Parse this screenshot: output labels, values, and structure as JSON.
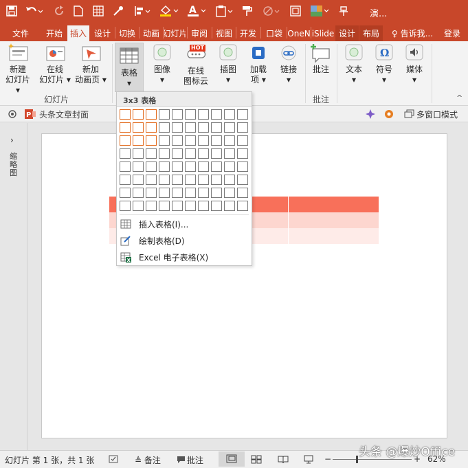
{
  "title_bar": {
    "doc_title": "演...",
    "quick_access": [
      "save-icon",
      "undo-icon",
      "redo-icon",
      "new-file-icon",
      "grid-icon",
      "eyedropper-icon",
      "align-icon",
      "fill-color-icon",
      "font-color-icon",
      "paste-icon",
      "format-painter-icon",
      "shape-icon",
      "frame-icon",
      "color-icon",
      "more-icon"
    ]
  },
  "tabs": [
    "文件",
    "开始",
    "插入",
    "设计",
    "切换",
    "动画",
    "幻灯片",
    "审阅",
    "视图",
    "开发",
    "口袋",
    "OneN",
    "iSlide",
    "设计",
    "布局"
  ],
  "active_tab": "插入",
  "tell_me": "♀ 告诉我...",
  "login": "登录",
  "ribbon": {
    "new_slide": "新建\n幻灯片 ▾",
    "online_slide": "在线\n幻灯片 ▾",
    "new_anim": "新加\n动画页 ▾",
    "table": "表格\n▾",
    "image": "图像\n▾",
    "online_icons": "在线\n图标云",
    "hot_badge": "HOT",
    "illustrations": "插图\n▾",
    "addins": "加载\n项 ▾",
    "link": "链接\n▾",
    "comment": "批注",
    "text": "文本\n▾",
    "symbol": "符号\n▾",
    "media": "媒体\n▾",
    "groups": {
      "slides": "幻灯片",
      "comments": "批注"
    }
  },
  "strip": {
    "doc_name": "头条文章封面",
    "multiwindow": "多窗口模式"
  },
  "thumbnails_label": "缩略图",
  "dropdown": {
    "header": "3x3 表格",
    "grid_cols": 10,
    "grid_rows": 8,
    "selected_cols": 3,
    "selected_rows": 3,
    "items": [
      "插入表格(I)...",
      "绘制表格(D)",
      "Excel 电子表格(X)"
    ]
  },
  "slide_table_colors": {
    "header": "#f8705a",
    "row1": "#fdd6cf",
    "row2": "#feebe8"
  },
  "status": {
    "slide_info": "幻灯片 第 1 张，共 1 张",
    "notes": "≜ 备注",
    "comments": "批注",
    "zoom": "62%",
    "watermark": "头条 @爆炒Office"
  }
}
